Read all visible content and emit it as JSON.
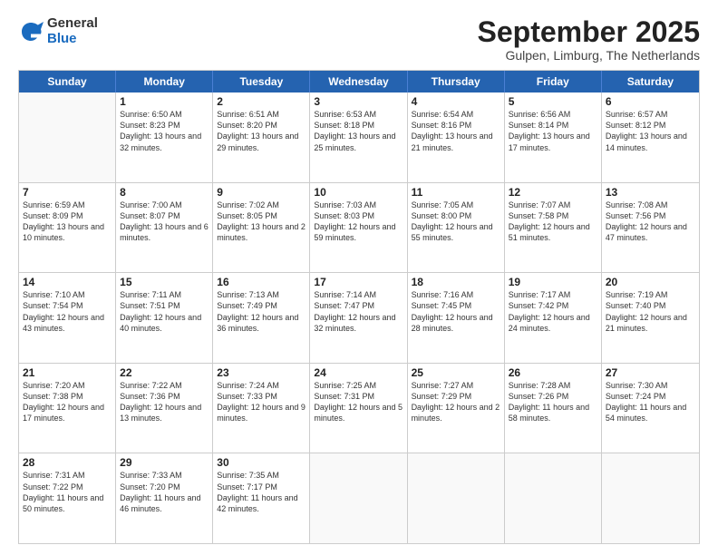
{
  "logo": {
    "general": "General",
    "blue": "Blue"
  },
  "title": "September 2025",
  "subtitle": "Gulpen, Limburg, The Netherlands",
  "header_days": [
    "Sunday",
    "Monday",
    "Tuesday",
    "Wednesday",
    "Thursday",
    "Friday",
    "Saturday"
  ],
  "weeks": [
    [
      {
        "day": "",
        "empty": true
      },
      {
        "day": "1",
        "sunrise": "Sunrise: 6:50 AM",
        "sunset": "Sunset: 8:23 PM",
        "daylight": "Daylight: 13 hours and 32 minutes."
      },
      {
        "day": "2",
        "sunrise": "Sunrise: 6:51 AM",
        "sunset": "Sunset: 8:20 PM",
        "daylight": "Daylight: 13 hours and 29 minutes."
      },
      {
        "day": "3",
        "sunrise": "Sunrise: 6:53 AM",
        "sunset": "Sunset: 8:18 PM",
        "daylight": "Daylight: 13 hours and 25 minutes."
      },
      {
        "day": "4",
        "sunrise": "Sunrise: 6:54 AM",
        "sunset": "Sunset: 8:16 PM",
        "daylight": "Daylight: 13 hours and 21 minutes."
      },
      {
        "day": "5",
        "sunrise": "Sunrise: 6:56 AM",
        "sunset": "Sunset: 8:14 PM",
        "daylight": "Daylight: 13 hours and 17 minutes."
      },
      {
        "day": "6",
        "sunrise": "Sunrise: 6:57 AM",
        "sunset": "Sunset: 8:12 PM",
        "daylight": "Daylight: 13 hours and 14 minutes."
      }
    ],
    [
      {
        "day": "7",
        "sunrise": "Sunrise: 6:59 AM",
        "sunset": "Sunset: 8:09 PM",
        "daylight": "Daylight: 13 hours and 10 minutes."
      },
      {
        "day": "8",
        "sunrise": "Sunrise: 7:00 AM",
        "sunset": "Sunset: 8:07 PM",
        "daylight": "Daylight: 13 hours and 6 minutes."
      },
      {
        "day": "9",
        "sunrise": "Sunrise: 7:02 AM",
        "sunset": "Sunset: 8:05 PM",
        "daylight": "Daylight: 13 hours and 2 minutes."
      },
      {
        "day": "10",
        "sunrise": "Sunrise: 7:03 AM",
        "sunset": "Sunset: 8:03 PM",
        "daylight": "Daylight: 12 hours and 59 minutes."
      },
      {
        "day": "11",
        "sunrise": "Sunrise: 7:05 AM",
        "sunset": "Sunset: 8:00 PM",
        "daylight": "Daylight: 12 hours and 55 minutes."
      },
      {
        "day": "12",
        "sunrise": "Sunrise: 7:07 AM",
        "sunset": "Sunset: 7:58 PM",
        "daylight": "Daylight: 12 hours and 51 minutes."
      },
      {
        "day": "13",
        "sunrise": "Sunrise: 7:08 AM",
        "sunset": "Sunset: 7:56 PM",
        "daylight": "Daylight: 12 hours and 47 minutes."
      }
    ],
    [
      {
        "day": "14",
        "sunrise": "Sunrise: 7:10 AM",
        "sunset": "Sunset: 7:54 PM",
        "daylight": "Daylight: 12 hours and 43 minutes."
      },
      {
        "day": "15",
        "sunrise": "Sunrise: 7:11 AM",
        "sunset": "Sunset: 7:51 PM",
        "daylight": "Daylight: 12 hours and 40 minutes."
      },
      {
        "day": "16",
        "sunrise": "Sunrise: 7:13 AM",
        "sunset": "Sunset: 7:49 PM",
        "daylight": "Daylight: 12 hours and 36 minutes."
      },
      {
        "day": "17",
        "sunrise": "Sunrise: 7:14 AM",
        "sunset": "Sunset: 7:47 PM",
        "daylight": "Daylight: 12 hours and 32 minutes."
      },
      {
        "day": "18",
        "sunrise": "Sunrise: 7:16 AM",
        "sunset": "Sunset: 7:45 PM",
        "daylight": "Daylight: 12 hours and 28 minutes."
      },
      {
        "day": "19",
        "sunrise": "Sunrise: 7:17 AM",
        "sunset": "Sunset: 7:42 PM",
        "daylight": "Daylight: 12 hours and 24 minutes."
      },
      {
        "day": "20",
        "sunrise": "Sunrise: 7:19 AM",
        "sunset": "Sunset: 7:40 PM",
        "daylight": "Daylight: 12 hours and 21 minutes."
      }
    ],
    [
      {
        "day": "21",
        "sunrise": "Sunrise: 7:20 AM",
        "sunset": "Sunset: 7:38 PM",
        "daylight": "Daylight: 12 hours and 17 minutes."
      },
      {
        "day": "22",
        "sunrise": "Sunrise: 7:22 AM",
        "sunset": "Sunset: 7:36 PM",
        "daylight": "Daylight: 12 hours and 13 minutes."
      },
      {
        "day": "23",
        "sunrise": "Sunrise: 7:24 AM",
        "sunset": "Sunset: 7:33 PM",
        "daylight": "Daylight: 12 hours and 9 minutes."
      },
      {
        "day": "24",
        "sunrise": "Sunrise: 7:25 AM",
        "sunset": "Sunset: 7:31 PM",
        "daylight": "Daylight: 12 hours and 5 minutes."
      },
      {
        "day": "25",
        "sunrise": "Sunrise: 7:27 AM",
        "sunset": "Sunset: 7:29 PM",
        "daylight": "Daylight: 12 hours and 2 minutes."
      },
      {
        "day": "26",
        "sunrise": "Sunrise: 7:28 AM",
        "sunset": "Sunset: 7:26 PM",
        "daylight": "Daylight: 11 hours and 58 minutes."
      },
      {
        "day": "27",
        "sunrise": "Sunrise: 7:30 AM",
        "sunset": "Sunset: 7:24 PM",
        "daylight": "Daylight: 11 hours and 54 minutes."
      }
    ],
    [
      {
        "day": "28",
        "sunrise": "Sunrise: 7:31 AM",
        "sunset": "Sunset: 7:22 PM",
        "daylight": "Daylight: 11 hours and 50 minutes."
      },
      {
        "day": "29",
        "sunrise": "Sunrise: 7:33 AM",
        "sunset": "Sunset: 7:20 PM",
        "daylight": "Daylight: 11 hours and 46 minutes."
      },
      {
        "day": "30",
        "sunrise": "Sunrise: 7:35 AM",
        "sunset": "Sunset: 7:17 PM",
        "daylight": "Daylight: 11 hours and 42 minutes."
      },
      {
        "day": "",
        "empty": true
      },
      {
        "day": "",
        "empty": true
      },
      {
        "day": "",
        "empty": true
      },
      {
        "day": "",
        "empty": true
      }
    ]
  ]
}
